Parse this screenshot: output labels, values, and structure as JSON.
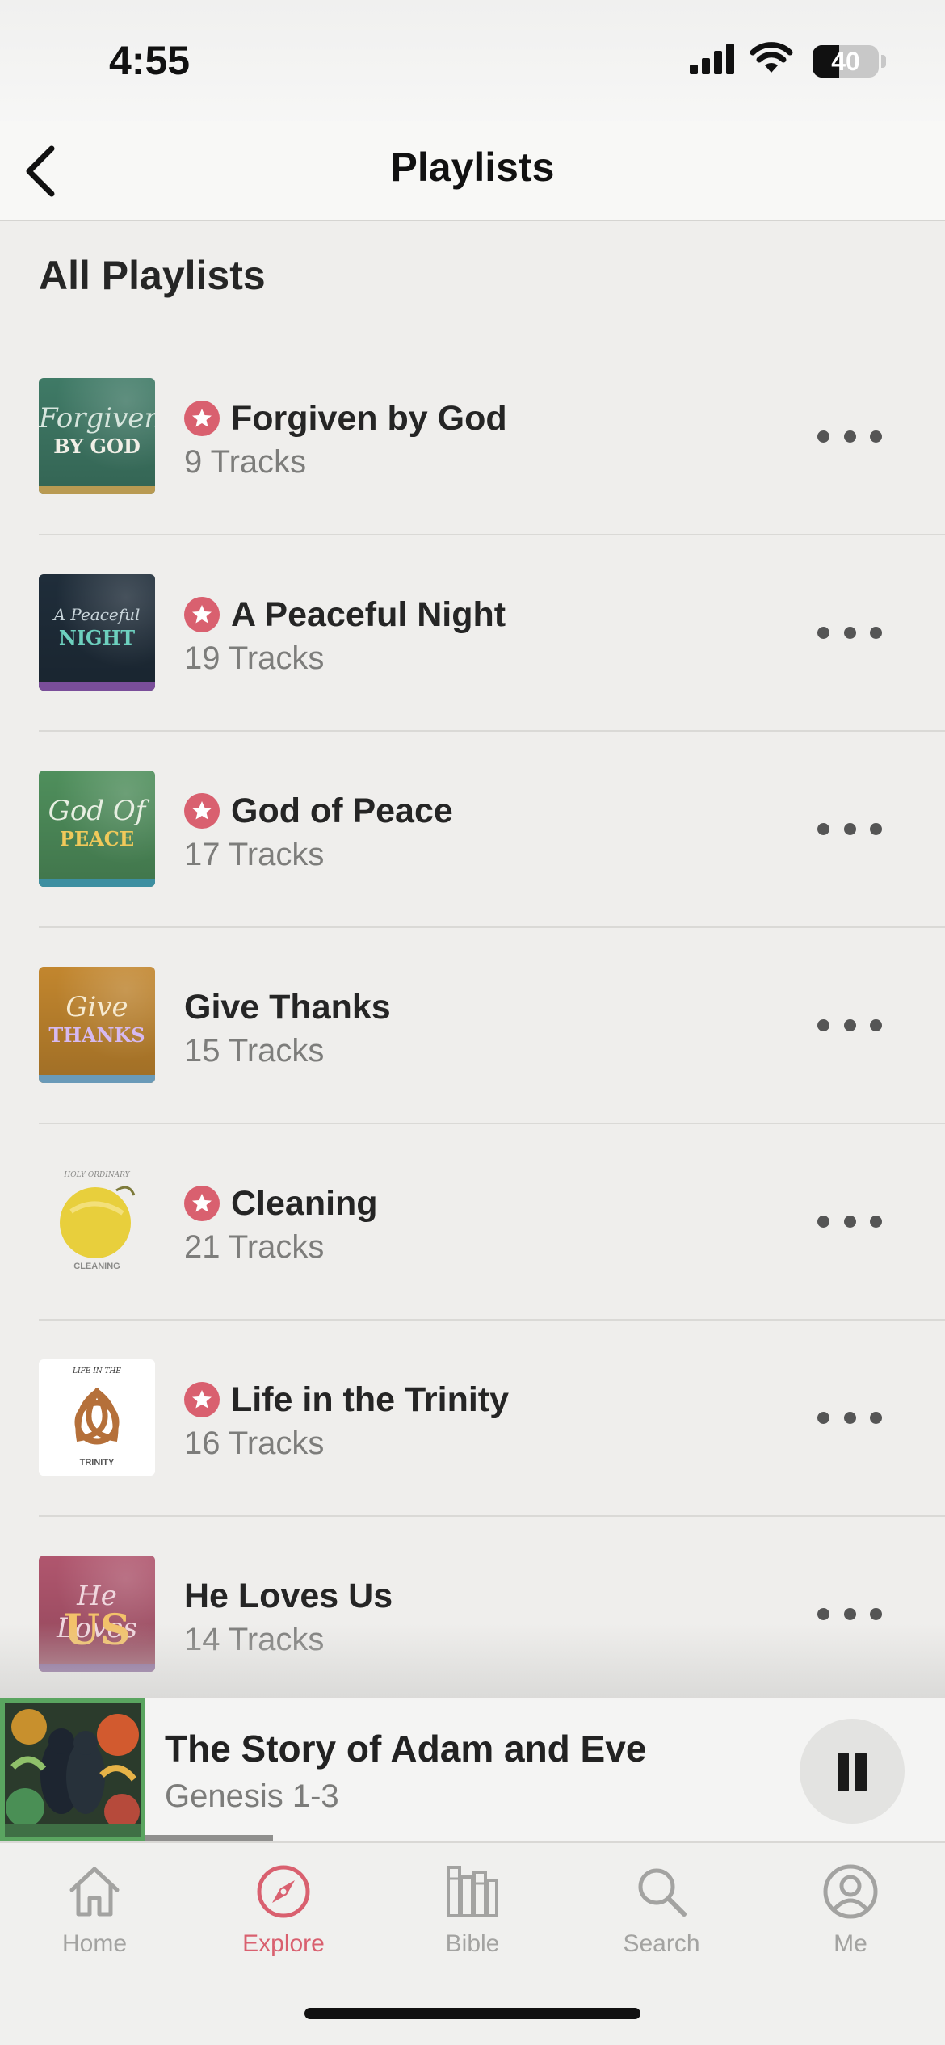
{
  "status_bar": {
    "time": "4:55",
    "battery": "40",
    "battery_level_percent": 40
  },
  "nav": {
    "title": "Playlists"
  },
  "section_title": "All Playlists",
  "playlists": [
    {
      "title": "Forgiven by God",
      "tracks": "9 Tracks",
      "starred": true,
      "cover": {
        "top": "Forgiven",
        "bottom": "BY GOD",
        "bg": "#3f7a66",
        "top_color": "#d8e6de",
        "bottom_color": "#f1efe6",
        "stripe": "#b99a52"
      }
    },
    {
      "title": "A Peaceful Night",
      "tracks": "19 Tracks",
      "starred": true,
      "cover": {
        "top": "A Peaceful",
        "bottom": "NIGHT",
        "bg": "#1f2d3a",
        "top_color": "#c8d4da",
        "bottom_color": "#6dd0be",
        "stripe": "#7a4e9a"
      }
    },
    {
      "title": "God of Peace",
      "tracks": "17 Tracks",
      "starred": true,
      "cover": {
        "top": "God Of",
        "bottom": "PEACE",
        "bg": "#4f8f5c",
        "top_color": "#e7efe2",
        "bottom_color": "#f0c95a",
        "stripe": "#3d8fa1"
      }
    },
    {
      "title": "Give Thanks",
      "tracks": "15 Tracks",
      "starred": false,
      "cover": {
        "top": "Give",
        "bottom": "THANKS",
        "bg": "#c2862e",
        "top_color": "#f6ead0",
        "bottom_color": "#d6b9f0",
        "stripe": "#6a9ab8"
      }
    },
    {
      "title": "Cleaning",
      "tracks": "21 Tracks",
      "starred": true,
      "cover": {
        "top": "HOLY ORDINARY",
        "bottom": "CLEANING",
        "bg": "#efeeec",
        "top_color": "#8a8a88",
        "bottom_color": "#8a8a88",
        "stripe": "#efeeec"
      }
    },
    {
      "title": "Life in the Trinity",
      "tracks": "16 Tracks",
      "starred": true,
      "cover": {
        "top": "LIFE IN THE",
        "bottom": "TRINITY",
        "bg": "#ffffff",
        "top_color": "#333333",
        "bottom_color": "#555555",
        "stripe": "#ffffff"
      }
    },
    {
      "title": "He Loves Us",
      "tracks": "14 Tracks",
      "starred": false,
      "cover": {
        "top": "He Loves",
        "bottom": "US",
        "bg": "#b0566e",
        "top_color": "#f0d7de",
        "bottom_color": "#f3c26a",
        "stripe": "#7f5b91"
      }
    }
  ],
  "now_playing": {
    "title": "The Story of Adam and Eve",
    "subtitle": "Genesis 1-3",
    "progress": 0.16
  },
  "tabs": [
    {
      "label": "Home",
      "icon": "house-icon",
      "active": false
    },
    {
      "label": "Explore",
      "icon": "compass-icon",
      "active": true
    },
    {
      "label": "Bible",
      "icon": "bible-books-icon",
      "active": false
    },
    {
      "label": "Search",
      "icon": "search-icon",
      "active": false
    },
    {
      "label": "Me",
      "icon": "person-circle-icon",
      "active": false
    }
  ],
  "colors": {
    "accent": "#d9606f",
    "inactive_tab": "#a3a3a1",
    "background": "#efeeec"
  }
}
